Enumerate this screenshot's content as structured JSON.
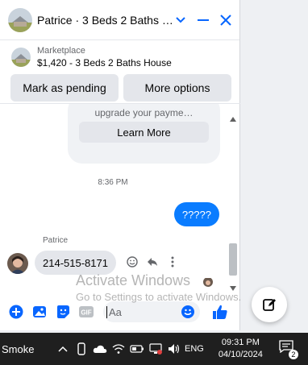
{
  "header": {
    "title": "Patrice · 3 Beds 2 Baths Ho…",
    "icons": [
      "chevron-down-icon",
      "minimize-icon",
      "close-icon"
    ]
  },
  "marketplace": {
    "label": "Marketplace",
    "listing": "$1,420 - 3 Beds 2 Baths House"
  },
  "actions": {
    "pending_label": "Mark as pending",
    "more_label": "More options"
  },
  "thread": {
    "card_text": "upgrade your payme…",
    "learn_more_label": "Learn More",
    "timestamp": "8:36 PM",
    "outgoing_message": "?????",
    "sender_name": "Patrice",
    "incoming_message": "214-515-8171"
  },
  "composer": {
    "placeholder": "Aa",
    "icons": [
      "plus-icon",
      "photo-icon",
      "sticker-icon",
      "gif-icon",
      "emoji-icon",
      "like-icon"
    ]
  },
  "watermark": {
    "title": "Activate Windows",
    "subtitle": "Go to Settings to activate Windows."
  },
  "taskbar": {
    "weather": "Smoke",
    "language": "ENG",
    "time": "09:31 PM",
    "date": "04/10/2024",
    "notification_count": "2"
  },
  "colors": {
    "accent": "#0a7cff",
    "header_icons": "#0866ff"
  }
}
